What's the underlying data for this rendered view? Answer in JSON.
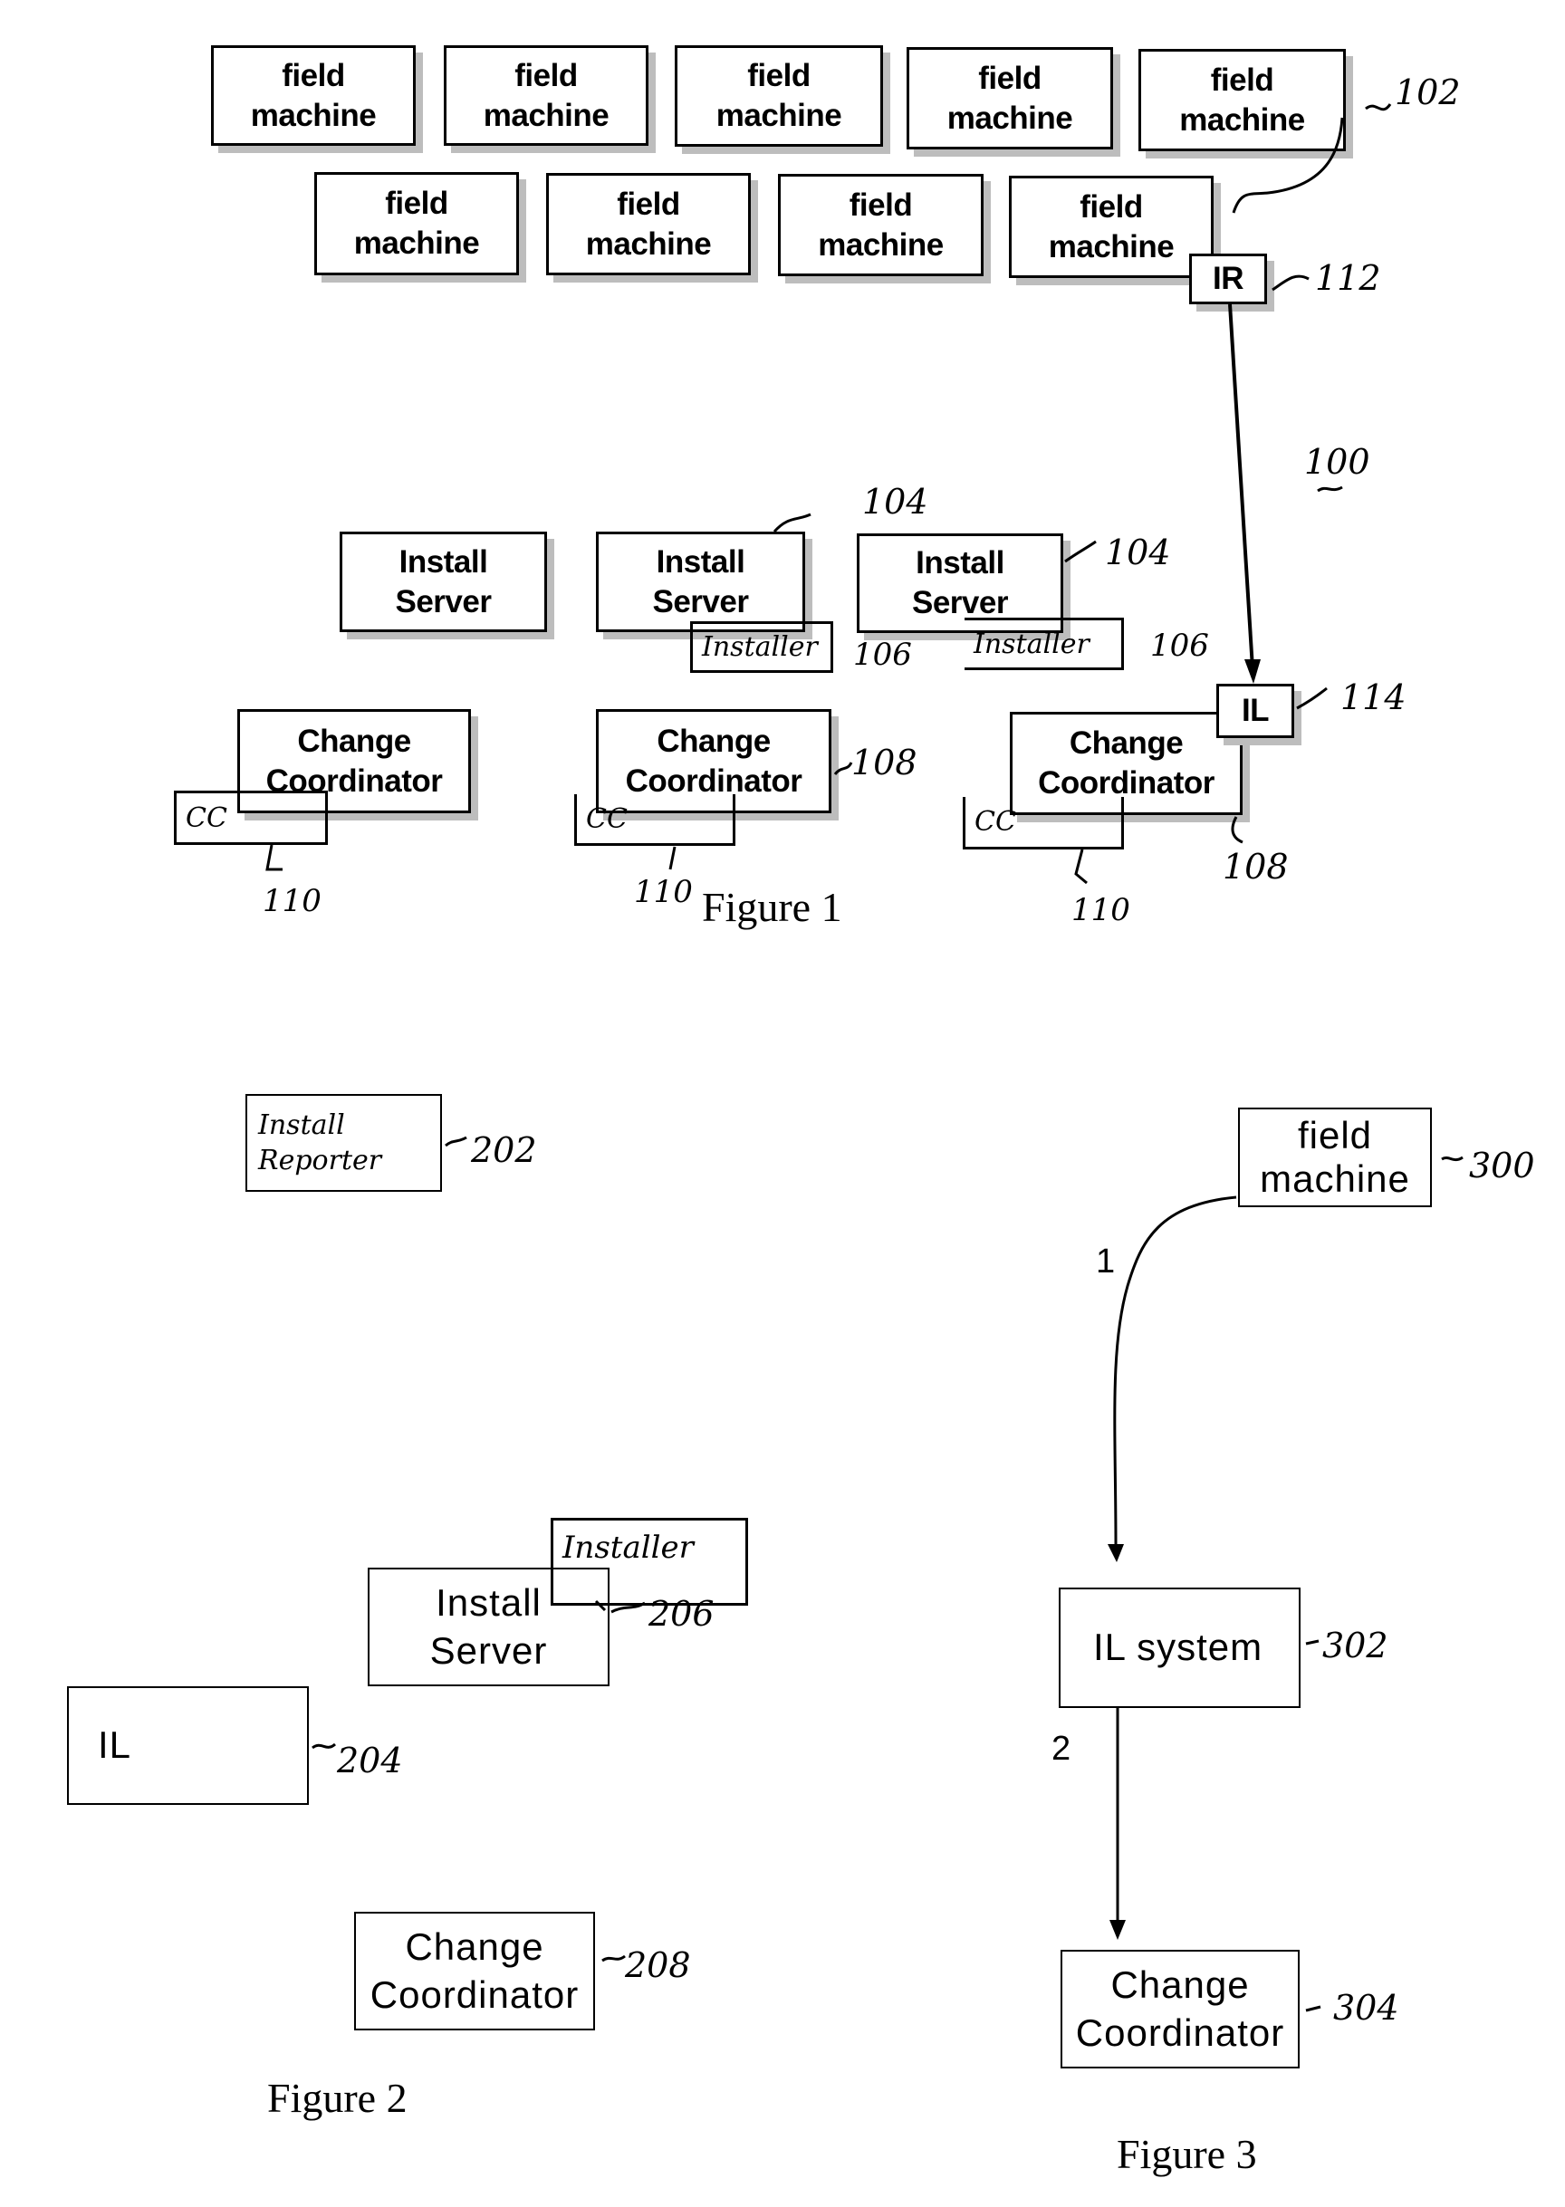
{
  "figure1": {
    "caption": "Figure 1",
    "system_ref": "100",
    "field_machines": [
      {
        "label_line1": "field",
        "label_line2": "machine"
      },
      {
        "label_line1": "field",
        "label_line2": "machine"
      },
      {
        "label_line1": "field",
        "label_line2": "machine"
      },
      {
        "label_line1": "field",
        "label_line2": "machine"
      },
      {
        "label_line1": "field",
        "label_line2": "machine"
      },
      {
        "label_line1": "field",
        "label_line2": "machine"
      },
      {
        "label_line1": "field",
        "label_line2": "machine"
      },
      {
        "label_line1": "field",
        "label_line2": "machine"
      },
      {
        "label_line1": "field",
        "label_line2": "machine"
      }
    ],
    "field_machines_ref": "102",
    "ir": {
      "label": "IR",
      "ref": "112"
    },
    "install_servers": [
      {
        "label_line1": "Install",
        "label_line2": "Server",
        "ref": ""
      },
      {
        "label_line1": "Install",
        "label_line2": "Server",
        "ref": "104",
        "installer": "Installer",
        "installer_ref": "106"
      },
      {
        "label_line1": "Install",
        "label_line2": "Server",
        "ref": "104",
        "installer": "Installer",
        "installer_ref": "106"
      }
    ],
    "change_coordinators": [
      {
        "label_line1": "Change",
        "label_line2": "Coordinator",
        "cc": "CC",
        "cc_ref": "110",
        "ref": ""
      },
      {
        "label_line1": "Change",
        "label_line2": "Coordinator",
        "cc": "CC",
        "cc_ref": "110",
        "ref": "108"
      },
      {
        "label_line1": "Change",
        "label_line2": "Coordinator",
        "cc": "CC",
        "cc_ref": "110",
        "ref": "108"
      }
    ],
    "il": {
      "label": "IL",
      "ref": "114"
    }
  },
  "figure2": {
    "caption": "Figure 2",
    "install_reporter": {
      "label_line1": "Install",
      "label_line2": "Reporter",
      "ref": "202"
    },
    "install_server": {
      "label_line1": "Install",
      "label_line2": "Server",
      "installer": "Installer",
      "installer_ref": "206"
    },
    "il": {
      "label": "IL",
      "ref": "204"
    },
    "change_coordinator": {
      "label_line1": "Change",
      "label_line2": "Coordinator",
      "ref": "208"
    }
  },
  "figure3": {
    "caption": "Figure 3",
    "field_machine": {
      "label_line1": "field",
      "label_line2": "machine",
      "ref": "300"
    },
    "il_system": {
      "label": "IL system",
      "ref": "302"
    },
    "change_coordinator": {
      "label_line1": "Change",
      "label_line2": "Coordinator",
      "ref": "304"
    },
    "steps": [
      "1",
      "2"
    ]
  }
}
